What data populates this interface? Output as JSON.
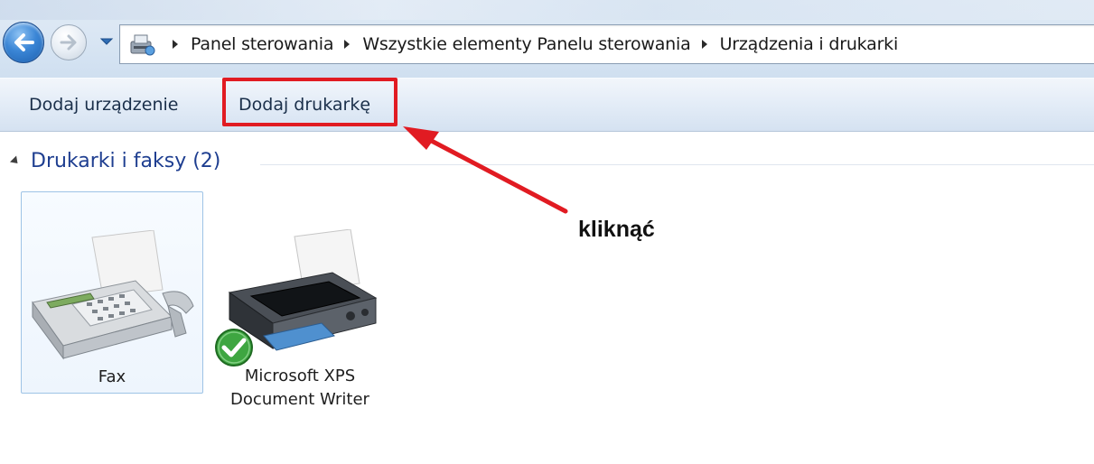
{
  "breadcrumb": {
    "items": [
      "Panel sterowania",
      "Wszystkie elementy Panelu sterowania",
      "Urządzenia i drukarki"
    ]
  },
  "toolbar": {
    "add_device_label": "Dodaj urządzenie",
    "add_printer_label": "Dodaj drukarkę"
  },
  "group": {
    "title": "Drukarki i faksy (2)"
  },
  "devices": [
    {
      "label_line1": "Fax",
      "label_line2": "",
      "icon": "fax-icon",
      "selected": true
    },
    {
      "label_line1": "Microsoft XPS",
      "label_line2": "Document Writer",
      "icon": "printer-icon",
      "default": true
    }
  ],
  "annotation": {
    "text": "kliknąć",
    "color": "#e11b22"
  },
  "icons": {
    "back": "back-arrow-icon",
    "forward": "forward-arrow-icon",
    "history": "history-dropdown-icon",
    "control_panel": "control-panel-icon",
    "default_check": "default-checkmark-icon"
  }
}
